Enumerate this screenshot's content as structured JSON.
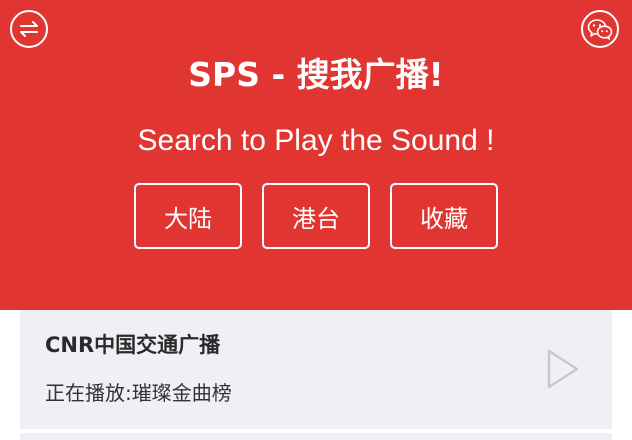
{
  "header": {
    "title": "SPS - 搜我广播!",
    "subtitle": "Search to Play the Sound !",
    "left_icon": "swap-arrows-icon",
    "right_icon": "wechat-icon",
    "background_color": "#e03530"
  },
  "regions": [
    {
      "label": "大陆"
    },
    {
      "label": "港台"
    },
    {
      "label": "收藏"
    }
  ],
  "stations": [
    {
      "name": "CNR中国交通广播",
      "status": "正在播放:璀璨金曲榜",
      "icon": "play-icon"
    }
  ]
}
